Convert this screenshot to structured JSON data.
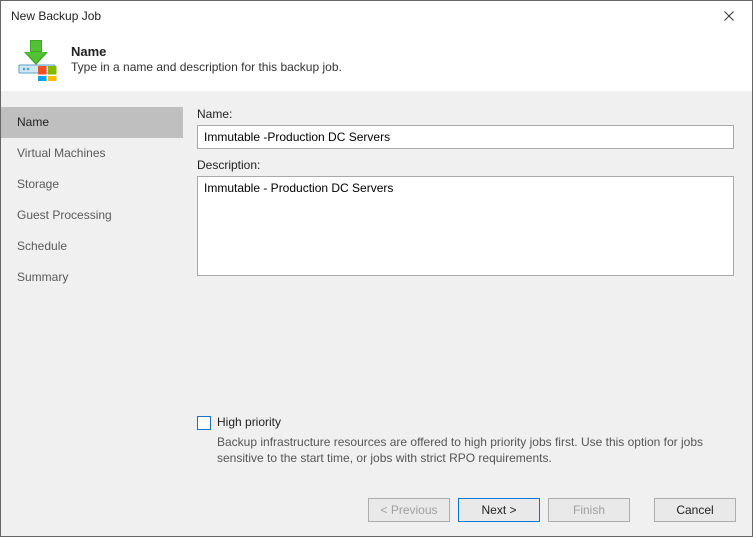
{
  "window": {
    "title": "New Backup Job"
  },
  "header": {
    "title": "Name",
    "subtitle": "Type in a name and description for this backup job."
  },
  "sidebar": {
    "items": [
      {
        "label": "Name",
        "active": true
      },
      {
        "label": "Virtual Machines",
        "active": false
      },
      {
        "label": "Storage",
        "active": false
      },
      {
        "label": "Guest Processing",
        "active": false
      },
      {
        "label": "Schedule",
        "active": false
      },
      {
        "label": "Summary",
        "active": false
      }
    ]
  },
  "main": {
    "name_label": "Name:",
    "name_value": "Immutable -Production DC Servers",
    "description_label": "Description:",
    "description_value": "Immutable - Production DC Servers",
    "high_priority_label": "High priority",
    "high_priority_checked": false,
    "high_priority_hint": "Backup infrastructure resources are offered to high priority jobs first. Use this option for jobs sensitive to the start time, or jobs with strict RPO requirements."
  },
  "footer": {
    "previous": "< Previous",
    "next": "Next >",
    "finish": "Finish",
    "cancel": "Cancel"
  }
}
